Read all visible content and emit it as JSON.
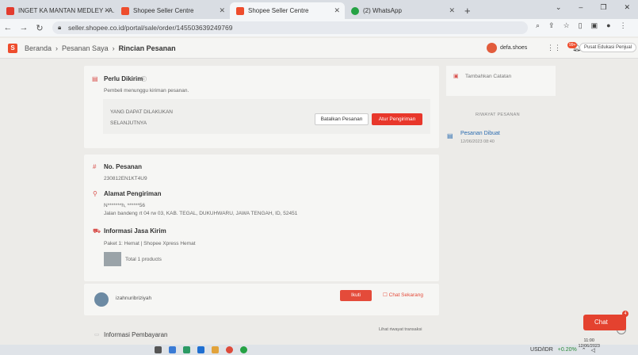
{
  "browser": {
    "tabs": [
      {
        "title": "INGET KA MANTAN MEDLEY - A...",
        "color": "#e33b2e"
      },
      {
        "title": "Shopee Seller Centre",
        "color": "#ee4d2d"
      },
      {
        "title": "Shopee Seller Centre",
        "color": "#ee4d2d"
      },
      {
        "title": "(2) WhatsApp",
        "color": "#25a244"
      }
    ],
    "url": "seller.shopee.co.id/portal/sale/order/145503639249769"
  },
  "header": {
    "breadcrumbs": [
      "Beranda",
      "Pesanan Saya",
      "Rincian Pesanan"
    ],
    "shop_name": "defa.shoes",
    "notif_badge": "99+",
    "edu_label": "Pusat Edukasi Penjual"
  },
  "status_card": {
    "title": "Perlu Dikirim",
    "subtitle": "Pembeli menunggu kiriman pesanan.",
    "hint1": "YANG DAPAT DILAKUKAN",
    "hint2": "SELANJUTNYA",
    "cancel_label": "Batalkan Pesanan",
    "ship_label": "Atur Pengiriman"
  },
  "right_panel": {
    "note_label": "Tambahkan Catatan",
    "history_title": "RIWAYAT PESANAN",
    "event": "Pesanan Dibuat",
    "event_date": "12/06/2023 08:40"
  },
  "order": {
    "no_label": "No. Pesanan",
    "no_value": "230812EN1KT4U9",
    "address_label": "Alamat Pengiriman",
    "address_name": "N*******h, ******56",
    "address_line": "Jalan bandeng rt 04 rw 03, KAB. TEGAL, DUKUHWARU, JAWA TENGAH, ID, 52451",
    "shipping_label": "Informasi Jasa Kirim",
    "package_line": "Paket 1:  Hemat  |  Shopee Xpress Hemat",
    "products": "Total 1 products",
    "buyer": "izahnuribriziyah",
    "nuti_label": "Ikuti",
    "chat_label": "Chat Sekarang",
    "payment_label": "Informasi Pembayaran",
    "txn_label": "Lihat riwayat transaksi"
  },
  "chat_widget": {
    "label": "Chat",
    "badge": "4"
  },
  "taskbar": {
    "currency": "USD/IDR",
    "change": "+0.20%",
    "time": "11:00",
    "date": "12/06/2023"
  }
}
